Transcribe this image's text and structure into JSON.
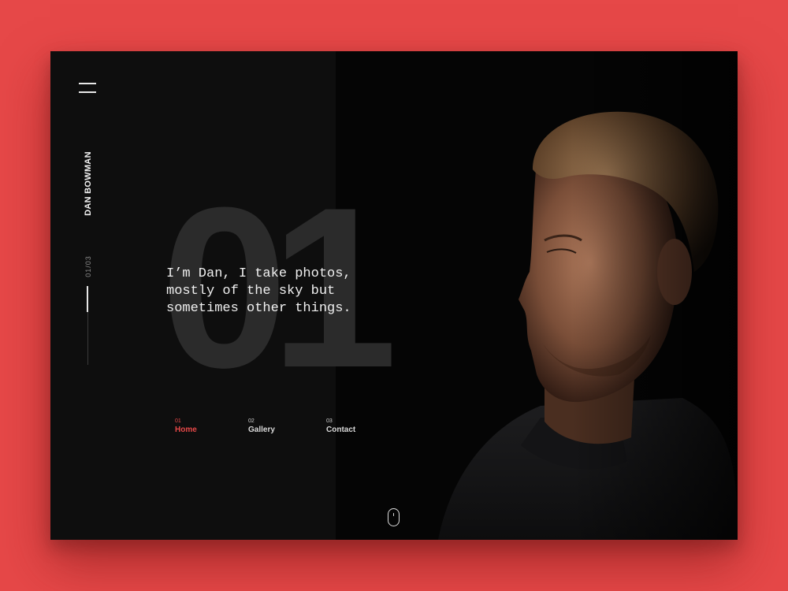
{
  "page": {
    "background_color": "#e64848",
    "accent_color": "#e64848"
  },
  "header": {
    "menu_icon": "hamburger-menu-icon",
    "brand_name": "DAN BOWMAN"
  },
  "pager": {
    "counter": "01/03",
    "progress_fraction": 0.33
  },
  "hero": {
    "slide_number": "01",
    "tagline_lines": [
      "I’m Dan, I take photos,",
      "mostly of the sky but",
      "sometimes other things."
    ]
  },
  "nav": {
    "items": [
      {
        "num": "01",
        "label": "Home",
        "active": true
      },
      {
        "num": "02",
        "label": "Gallery",
        "active": false
      },
      {
        "num": "03",
        "label": "Contact",
        "active": false
      }
    ]
  },
  "scroll_hint": {
    "icon": "mouse-scroll-icon"
  }
}
